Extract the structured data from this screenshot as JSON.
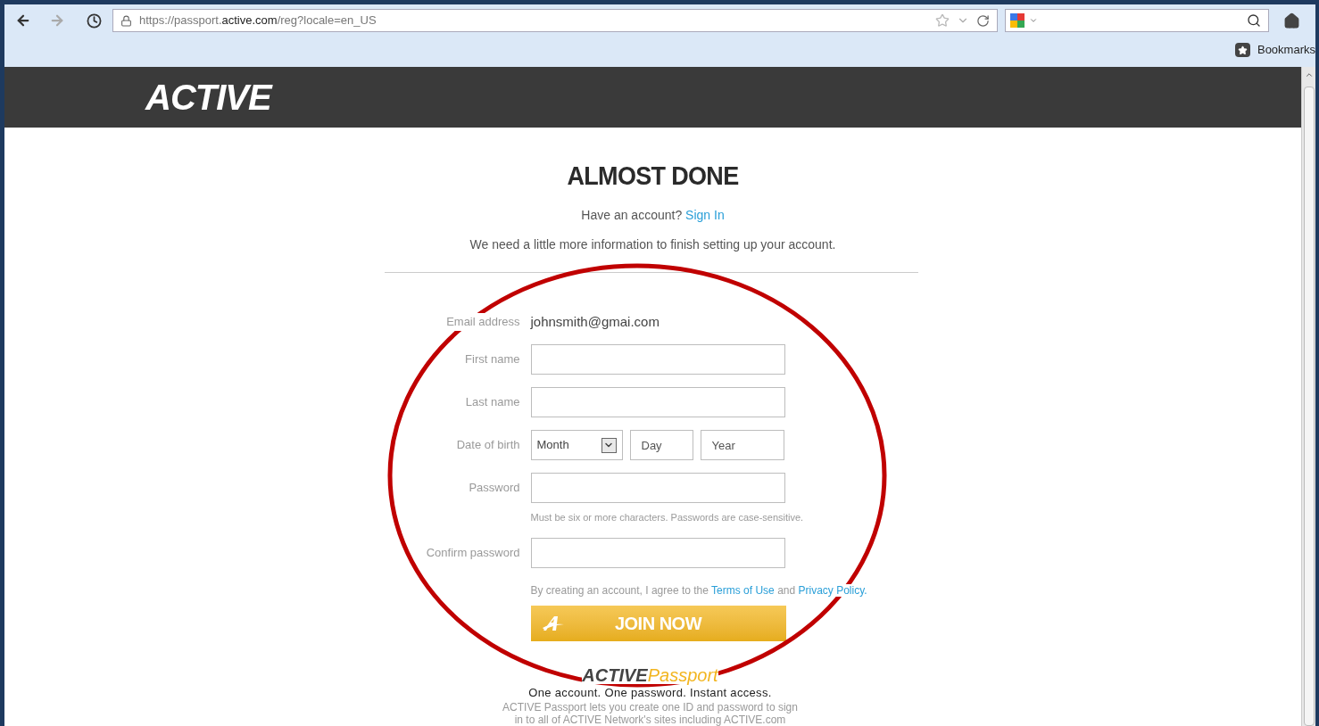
{
  "browser": {
    "url_prefix": "https://passport.",
    "url_domain": "active.com",
    "url_path": "/reg?locale=en_US",
    "bookmarks": "Bookmarks"
  },
  "header": {
    "logo": "ACTIVE"
  },
  "page": {
    "title": "ALMOST DONE",
    "account_prompt": "Have an account?",
    "sign_in": "Sign In",
    "intro": "We need a little more information to finish setting up your account.",
    "fields": [
      {
        "kind": "static",
        "label": "Email address",
        "value": "johnsmith@gmai.com"
      },
      {
        "kind": "text",
        "label": "First name"
      },
      {
        "kind": "text",
        "label": "Last name"
      },
      {
        "kind": "date",
        "label": "Date of birth",
        "month": "Month",
        "day_placeholder": "Day",
        "year_placeholder": "Year"
      },
      {
        "kind": "password",
        "label": "Password",
        "hint": "Must be six or more characters. Passwords are case-sensitive."
      },
      {
        "kind": "password",
        "label": "Confirm password"
      }
    ],
    "terms": {
      "prefix": "By creating an account, I agree to the",
      "terms_link": "Terms of Use",
      "middle": "and",
      "privacy_link": "Privacy Policy."
    },
    "join_button": "JOIN NOW",
    "passport": {
      "logo_active": "ACTIVE",
      "logo_passport": "Passport",
      "tagline": "One account. One password. Instant access.",
      "description": "ACTIVE Passport lets you create one ID and password to sign in to all of ACTIVE Network's sites including ACTIVE.com"
    }
  },
  "annotation": {
    "kind": "circle"
  }
}
